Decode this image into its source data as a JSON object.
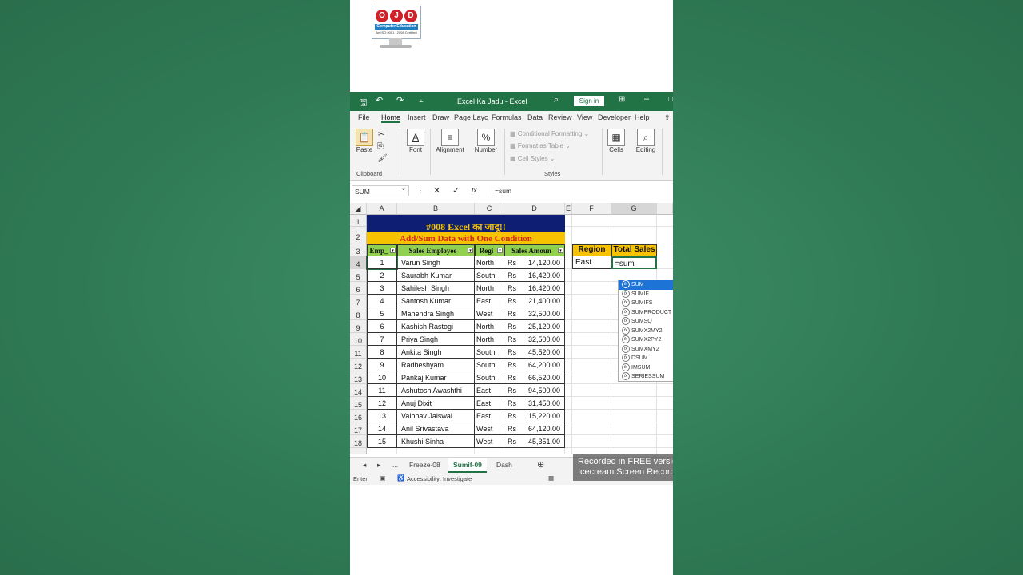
{
  "logo": {
    "letters": [
      "O",
      "J",
      "D"
    ],
    "band": "Computer Education",
    "sub": "An ISO 9001 : 2008 Certified"
  },
  "titlebar": {
    "title": "Excel Ka Jadu  -  Excel",
    "sign_in": "Sign in"
  },
  "menu": [
    "File",
    "Home",
    "Insert",
    "Draw",
    "Page Layc",
    "Formulas",
    "Data",
    "Review",
    "View",
    "Developer",
    "Help"
  ],
  "ribbon": {
    "paste": "Paste",
    "clipboard": "Clipboard",
    "font": "Font",
    "alignment": "Alignment",
    "number": "Number",
    "conditional": "Conditional Formatting",
    "format_table": "Format as Table",
    "cell_styles": "Cell Styles",
    "styles": "Styles",
    "cells": "Cells",
    "editing": "Editing"
  },
  "formula_bar": {
    "name_box": "SUM",
    "fx": "fx",
    "formula": "=sum"
  },
  "columns": [
    "A",
    "B",
    "C",
    "D",
    "E",
    "F",
    "G"
  ],
  "sheet": {
    "title": "#008 Excel का जादू!!",
    "subtitle": "Add/Sum Data with One Condition",
    "headers": [
      "Emp_",
      "Sales Employee",
      "Regi",
      "Sales Amoun"
    ],
    "currency": "Rs",
    "rows": [
      {
        "id": "1",
        "name": "Varun Singh",
        "region": "North",
        "amount": "14,120.00"
      },
      {
        "id": "2",
        "name": "Saurabh Kumar",
        "region": "South",
        "amount": "16,420.00"
      },
      {
        "id": "3",
        "name": "Sahilesh Singh",
        "region": "North",
        "amount": "16,420.00"
      },
      {
        "id": "4",
        "name": "Santosh Kumar",
        "region": "East",
        "amount": "21,400.00"
      },
      {
        "id": "5",
        "name": "Mahendra Singh",
        "region": "West",
        "amount": "32,500.00"
      },
      {
        "id": "6",
        "name": "Kashish Rastogi",
        "region": "North",
        "amount": "25,120.00"
      },
      {
        "id": "7",
        "name": "Priya Singh",
        "region": "North",
        "amount": "32,500.00"
      },
      {
        "id": "8",
        "name": "Ankita Singh",
        "region": "South",
        "amount": "45,520.00"
      },
      {
        "id": "9",
        "name": "Radheshyam",
        "region": "South",
        "amount": "64,200.00"
      },
      {
        "id": "10",
        "name": "Pankaj Kumar",
        "region": "South",
        "amount": "66,520.00"
      },
      {
        "id": "11",
        "name": "Ashutosh Awashthi",
        "region": "East",
        "amount": "94,500.00"
      },
      {
        "id": "12",
        "name": "Anuj Dixit",
        "region": "East",
        "amount": "31,450.00"
      },
      {
        "id": "13",
        "name": "Vaibhav Jaiswal",
        "region": "East",
        "amount": "15,220.00"
      },
      {
        "id": "14",
        "name": "Anil Srivastava",
        "region": "West",
        "amount": "64,120.00"
      },
      {
        "id": "15",
        "name": "Khushi Sinha",
        "region": "West",
        "amount": "45,351.00"
      }
    ],
    "summary": {
      "region_header": "Region",
      "total_header": "Total Sales",
      "region_value": "East",
      "formula_value": "=sum"
    }
  },
  "autocomplete": [
    "SUM",
    "SUMIF",
    "SUMIFS",
    "SUMPRODUCT",
    "SUMSQ",
    "SUMX2MY2",
    "SUMX2PY2",
    "SUMXMY2",
    "DSUM",
    "IMSUM",
    "SERIESSUM"
  ],
  "tabs": {
    "more": "...",
    "items": [
      "Freeze-08",
      "Sumif-09",
      "Dash"
    ],
    "active": "Sumif-09"
  },
  "status": {
    "mode": "Enter",
    "accessibility": "Accessibility: Investigate"
  },
  "watermark": {
    "line1": "Recorded in FREE version",
    "line2": "Icecream  Screen  Recorder"
  },
  "colors": {
    "excel_green": "#217346",
    "title_fill": "#0e1f73",
    "title_text": "#f5c400",
    "subtitle_fill": "#f7c300",
    "subtitle_text": "#d6261d",
    "header_fill": "#92d050",
    "summary_header_fill": "#f7c300",
    "autocomplete_selected": "#1e73d6"
  }
}
